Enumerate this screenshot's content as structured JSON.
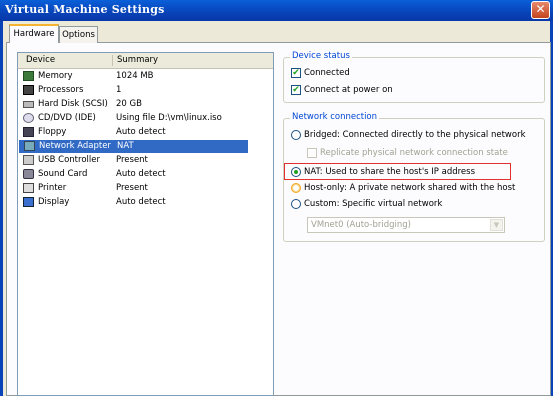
{
  "window": {
    "title": "Virtual Machine Settings",
    "close_glyph": "✕"
  },
  "tabs": [
    {
      "label": "Hardware"
    },
    {
      "label": "Options"
    }
  ],
  "device_list": {
    "columns": {
      "device": "Device",
      "summary": "Summary"
    },
    "rows": [
      {
        "device": "Memory",
        "summary": "1024 MB",
        "icon": "memory-icon"
      },
      {
        "device": "Processors",
        "summary": "1",
        "icon": "processor-icon"
      },
      {
        "device": "Hard Disk (SCSI)",
        "summary": "20 GB",
        "icon": "hard-disk-icon"
      },
      {
        "device": "CD/DVD (IDE)",
        "summary": "Using file D:\\vm\\linux.iso",
        "icon": "cd-dvd-icon"
      },
      {
        "device": "Floppy",
        "summary": "Auto detect",
        "icon": "floppy-icon"
      },
      {
        "device": "Network Adapter",
        "summary": "NAT",
        "icon": "network-adapter-icon",
        "selected": true
      },
      {
        "device": "USB Controller",
        "summary": "Present",
        "icon": "usb-icon"
      },
      {
        "device": "Sound Card",
        "summary": "Auto detect",
        "icon": "speaker-icon"
      },
      {
        "device": "Printer",
        "summary": "Present",
        "icon": "printer-icon"
      },
      {
        "device": "Display",
        "summary": "Auto detect",
        "icon": "monitor-icon"
      }
    ]
  },
  "device_status": {
    "label": "Device status",
    "connected": {
      "label": "Connected",
      "checked": true
    },
    "connect_at_power_on": {
      "label": "Connect at power on",
      "checked": true
    }
  },
  "network_connection": {
    "label": "Network connection",
    "bridged": "Bridged: Connected directly to the physical network",
    "replicate": "Replicate physical network connection state",
    "nat": "NAT: Used to share the host's IP address",
    "host_only": "Host-only: A private network shared with the host",
    "custom": "Custom: Specific virtual network",
    "selected": "nat",
    "vmnet_select": "VMnet0 (Auto-bridging)"
  },
  "colors": {
    "accent": "#0843b8",
    "selection": "#316ac5",
    "highlight_box": "#e03030"
  }
}
